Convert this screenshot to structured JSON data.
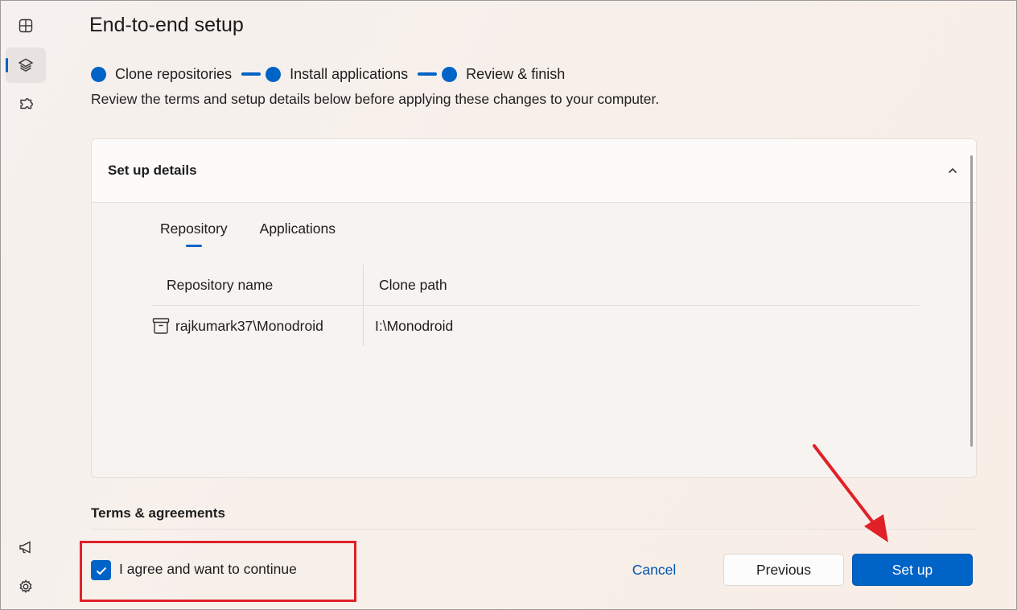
{
  "sidebar": {
    "items": [
      {
        "icon": "dashboard-icon"
      },
      {
        "icon": "layers-icon",
        "active": true
      },
      {
        "icon": "extensions-icon"
      }
    ],
    "bottom": [
      {
        "icon": "megaphone-icon"
      },
      {
        "icon": "settings-icon"
      }
    ]
  },
  "page": {
    "title": "End-to-end setup",
    "subtitle": "Review the terms and setup details below before applying these changes to your computer."
  },
  "steps": [
    {
      "label": "Clone repositories"
    },
    {
      "label": "Install applications"
    },
    {
      "label": "Review & finish"
    }
  ],
  "details": {
    "title": "Set up details",
    "tabs": [
      {
        "label": "Repository",
        "active": true
      },
      {
        "label": "Applications"
      }
    ],
    "columns": [
      "Repository name",
      "Clone path"
    ],
    "rows": [
      {
        "name": "rajkumark37\\Monodroid",
        "path": "I:\\Monodroid"
      }
    ]
  },
  "terms": {
    "heading": "Terms & agreements",
    "checkbox_label": "I agree and want to continue",
    "checked": true
  },
  "actions": {
    "cancel": "Cancel",
    "previous": "Previous",
    "setup": "Set up"
  },
  "colors": {
    "accent": "#0063c6",
    "annotation": "#e02128"
  }
}
